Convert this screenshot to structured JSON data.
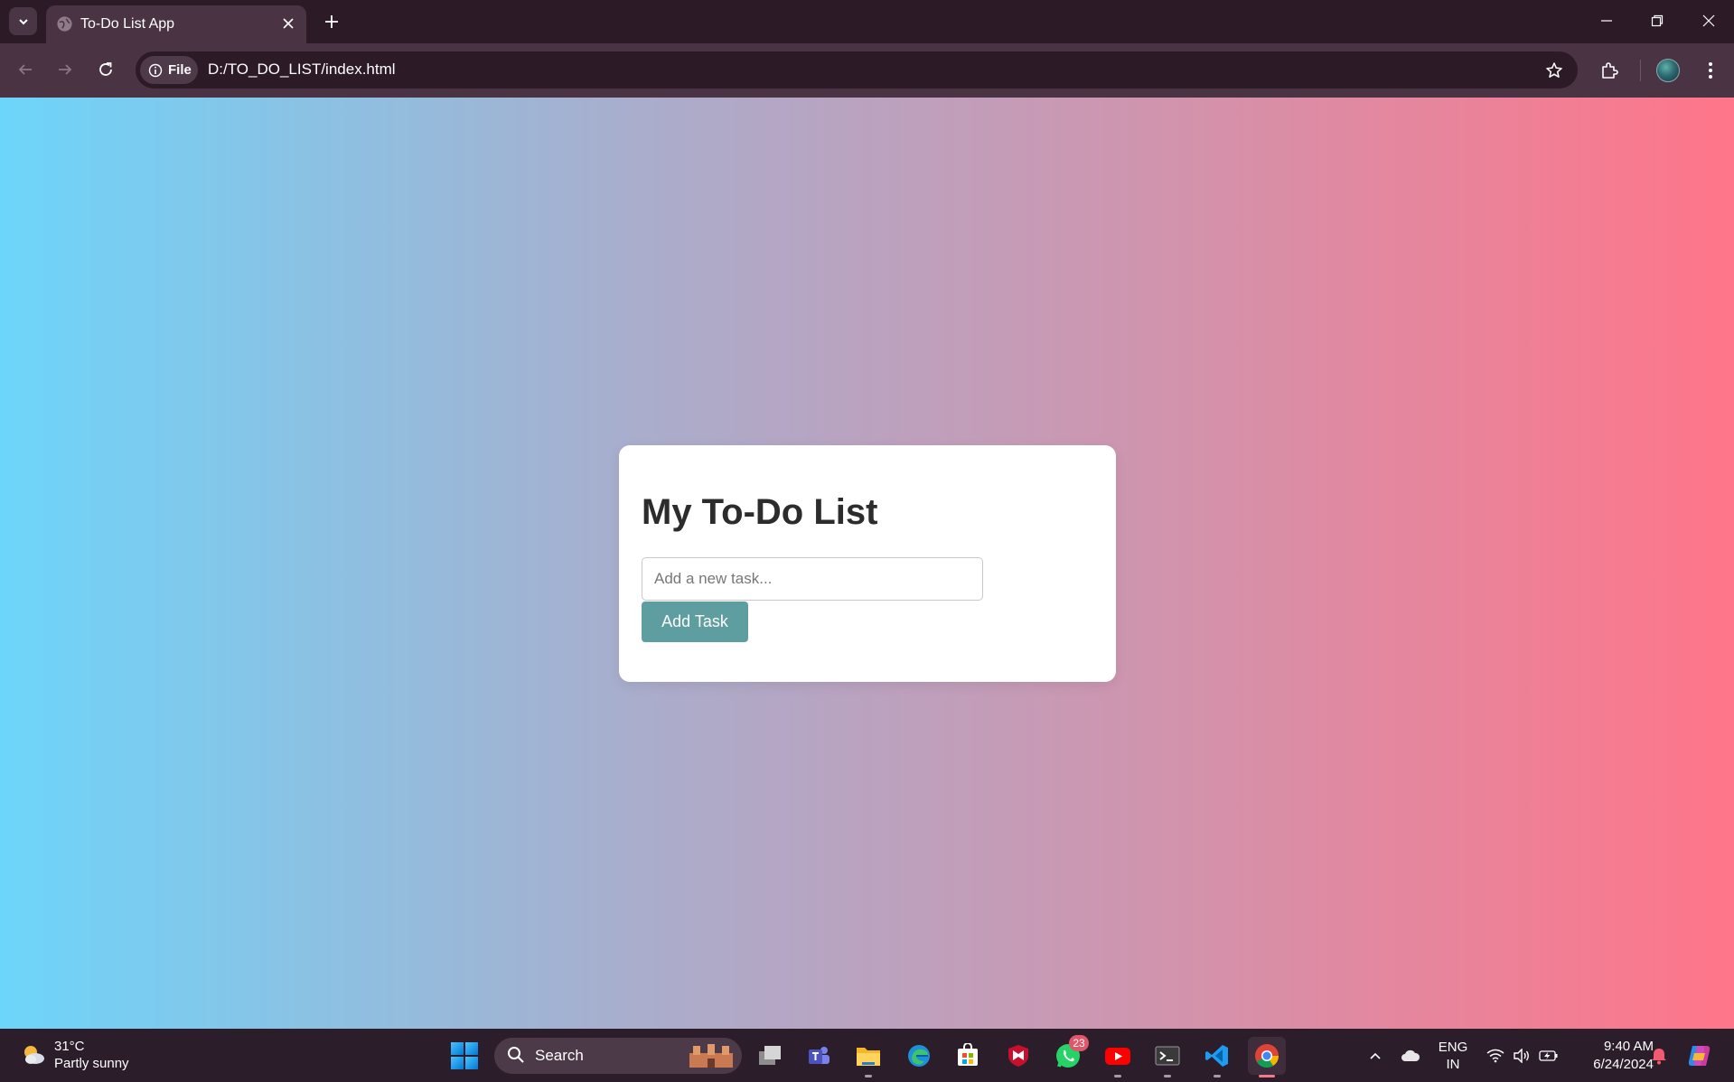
{
  "browser": {
    "tab_title": "To-Do List App",
    "address_chip_label": "File",
    "url": "D:/TO_DO_LIST/index.html"
  },
  "page": {
    "heading": "My To-Do List",
    "input_placeholder": "Add a new task...",
    "input_value": "",
    "add_button_label": "Add Task",
    "tasks": []
  },
  "colors": {
    "gradient_start": "#6dd5fa",
    "gradient_end": "#ff7589",
    "button": "#5f9ea0",
    "card": "#ffffff"
  },
  "taskbar": {
    "weather_temp": "31°C",
    "weather_desc": "Partly sunny",
    "search_label": "Search",
    "whatsapp_badge": "23",
    "language_line1": "ENG",
    "language_line2": "IN",
    "time": "9:40 AM",
    "date": "6/24/2024",
    "apps": [
      "task-view",
      "teams",
      "file-explorer",
      "edge",
      "microsoft-store",
      "mcafee",
      "whatsapp",
      "youtube",
      "terminal",
      "vscode",
      "chrome"
    ]
  }
}
